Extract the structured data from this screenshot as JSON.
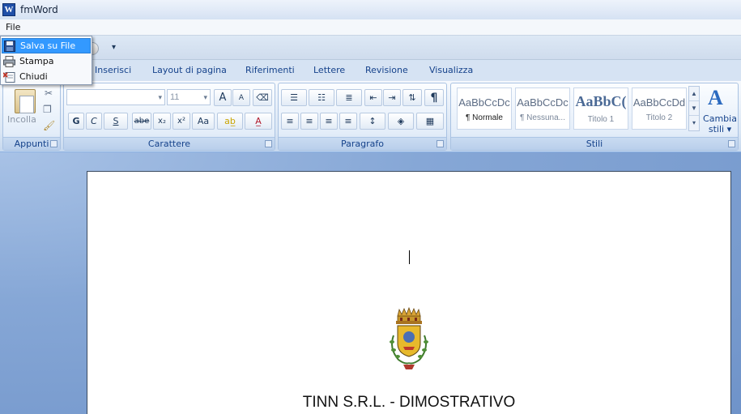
{
  "window": {
    "title": "fmWord",
    "app_icon": "W"
  },
  "menubar": {
    "file": "File"
  },
  "file_menu": [
    {
      "label": "Salva su File",
      "icon": "floppy-disk-icon",
      "highlighted": true
    },
    {
      "label": "Stampa",
      "icon": "printer-icon"
    },
    {
      "label": "Chiudi",
      "icon": "close-document-icon"
    }
  ],
  "tabs": [
    "Inserisci",
    "Layout di pagina",
    "Riferimenti",
    "Lettere",
    "Revisione",
    "Visualizza"
  ],
  "ribbon": {
    "appunti": {
      "label": "Appunti",
      "paste": "Incolla"
    },
    "carattere": {
      "label": "Carattere",
      "font_name": "",
      "font_size": "11",
      "bold": "G",
      "italic": "C",
      "underline": "S",
      "strike": "abe",
      "subscript": "x₂",
      "superscript": "x²",
      "change_case": "Aa",
      "grow": "A",
      "shrink": "A"
    },
    "paragrafo": {
      "label": "Paragrafo",
      "pilcrow": "¶"
    },
    "stili": {
      "label": "Stili",
      "styles": [
        {
          "sample": "AaBbCcDc",
          "name": "¶ Normale",
          "selected": true
        },
        {
          "sample": "AaBbCcDc",
          "name": "¶ Nessuna...",
          "selected": false
        },
        {
          "sample": "AaBbC(",
          "name": "Titolo 1",
          "selected": false
        },
        {
          "sample": "AaBbCcDd",
          "name": "Titolo 2",
          "selected": false
        }
      ],
      "change_styles": "Cambia stili ▾"
    }
  },
  "document": {
    "heading": "TINN S.R.L. - DIMOSTRATIVO"
  },
  "colors": {
    "accent": "#3399ff",
    "ribbon_text": "#15428b",
    "doc_background": "#7f9fd0"
  }
}
